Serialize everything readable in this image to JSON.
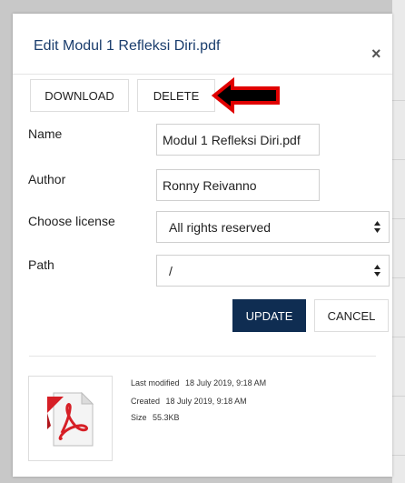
{
  "modal": {
    "title": "Edit Modul 1 Refleksi Diri.pdf",
    "close_symbol": "×"
  },
  "toolbar": {
    "download_label": "DOWNLOAD",
    "delete_label": "DELETE"
  },
  "form": {
    "name_label": "Name",
    "name_value": "Modul 1 Refleksi Diri.pdf",
    "author_label": "Author",
    "author_value": "Ronny Reivanno",
    "license_label": "Choose license",
    "license_value": "All rights reserved",
    "path_label": "Path",
    "path_value": "/"
  },
  "actions": {
    "update_label": "UPDATE",
    "cancel_label": "CANCEL"
  },
  "file_info": {
    "last_modified_label": "Last modified",
    "last_modified_value": "18 July 2019, 9:18 AM",
    "created_label": "Created",
    "created_value": "18 July 2019, 9:18 AM",
    "size_label": "Size",
    "size_value": "55.3KB"
  },
  "colors": {
    "title": "#1a3d6d",
    "primary_button": "#0f2d52",
    "arrow_fill": "#000000",
    "arrow_outline": "#e00000",
    "pdf_red": "#d61f26"
  },
  "icons": {
    "close": "close-icon",
    "select_arrows": "sort-arrows-icon",
    "file_thumbnail": "pdf-file-icon",
    "annotation": "arrow-left-icon"
  }
}
